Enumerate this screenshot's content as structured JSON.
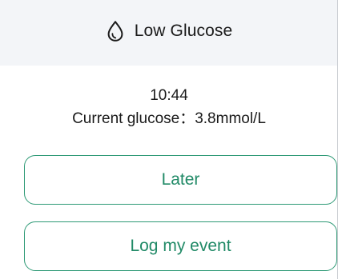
{
  "header": {
    "icon": "water-drop-icon",
    "title": "Low Glucose"
  },
  "info": {
    "time": "10:44",
    "glucose_text": "Current glucose：3.8mmol/L"
  },
  "buttons": {
    "later_label": "Later",
    "log_label": "Log my event"
  },
  "colors": {
    "accent": "#2e9a76",
    "header_bg": "#f3f5f8"
  }
}
